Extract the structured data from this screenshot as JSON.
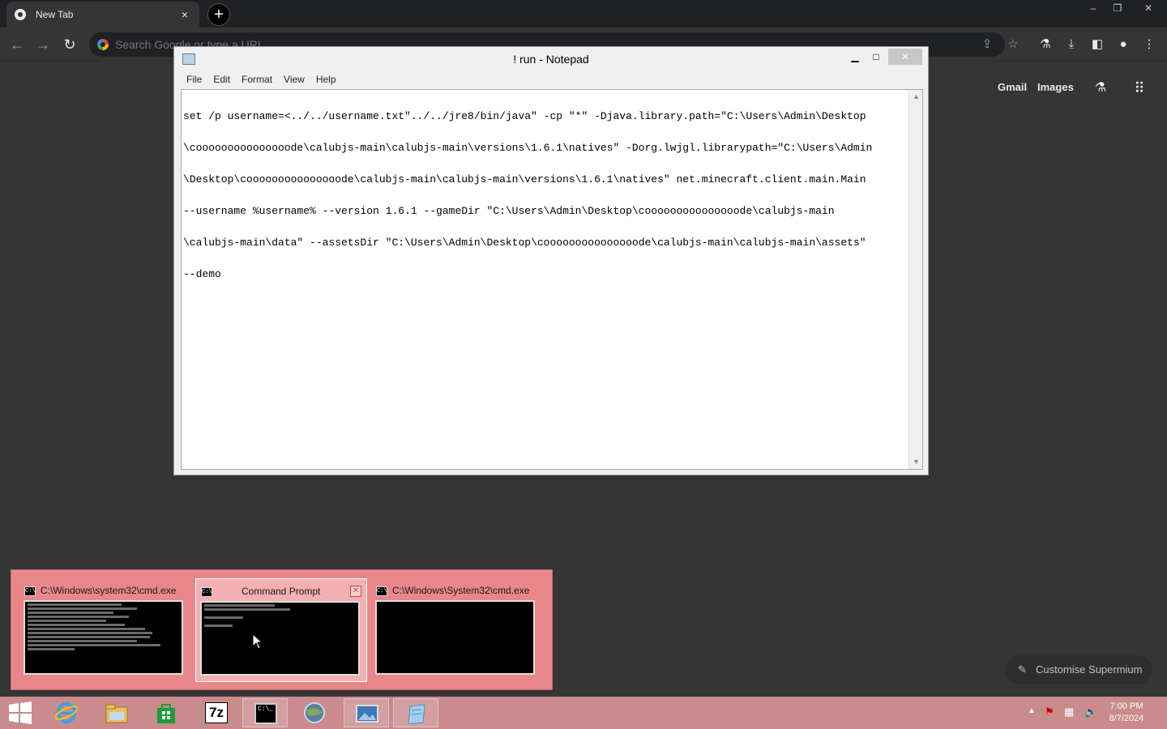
{
  "browser": {
    "tab_title": "New Tab",
    "tab_close": "×",
    "new_tab": "+",
    "omnibox_placeholder": "Search Google or type a URL",
    "window_controls": {
      "minimize": "–",
      "restore": "❐",
      "close": "✕"
    }
  },
  "ntp": {
    "gmail": "Gmail",
    "images": "Images",
    "customise": "Customise Supermium"
  },
  "notepad": {
    "title": "! run - Notepad",
    "menu": [
      "File",
      "Edit",
      "Format",
      "View",
      "Help"
    ],
    "lines": [
      "set /p username=<../../username.txt\"../../jre8/bin/java\" -cp \"*\" -Djava.library.path=\"C:\\Users\\Admin\\Desktop",
      "\\cooooooooooooooode\\calubjs-main\\calubjs-main\\versions\\1.6.1\\natives\" -Dorg.lwjgl.librarypath=\"C:\\Users\\Admin",
      "\\Desktop\\cooooooooooooooode\\calubjs-main\\calubjs-main\\versions\\1.6.1\\natives\" net.minecraft.client.main.Main",
      "--username %username% --version 1.6.1 --gameDir \"C:\\Users\\Admin\\Desktop\\cooooooooooooooode\\calubjs-main",
      "\\calubjs-main\\data\" --assetsDir \"C:\\Users\\Admin\\Desktop\\cooooooooooooooode\\calubjs-main\\calubjs-main\\assets\"",
      "--demo"
    ]
  },
  "thumbnails": [
    {
      "title": "C:\\Windows\\system32\\cmd.exe",
      "active": false
    },
    {
      "title": "Command Prompt",
      "active": true
    },
    {
      "title": "C:\\Windows\\System32\\cmd.exe",
      "active": false
    }
  ],
  "taskbar": {
    "clock_time": "7:00 PM",
    "clock_date": "8/7/2024",
    "sevenzip": "7z",
    "cmd_glyph": "C:\\_"
  },
  "colors": {
    "thumb_bg": "#e9868a",
    "taskbar_bg": "#c98b8b",
    "page_bg": "#353535"
  }
}
